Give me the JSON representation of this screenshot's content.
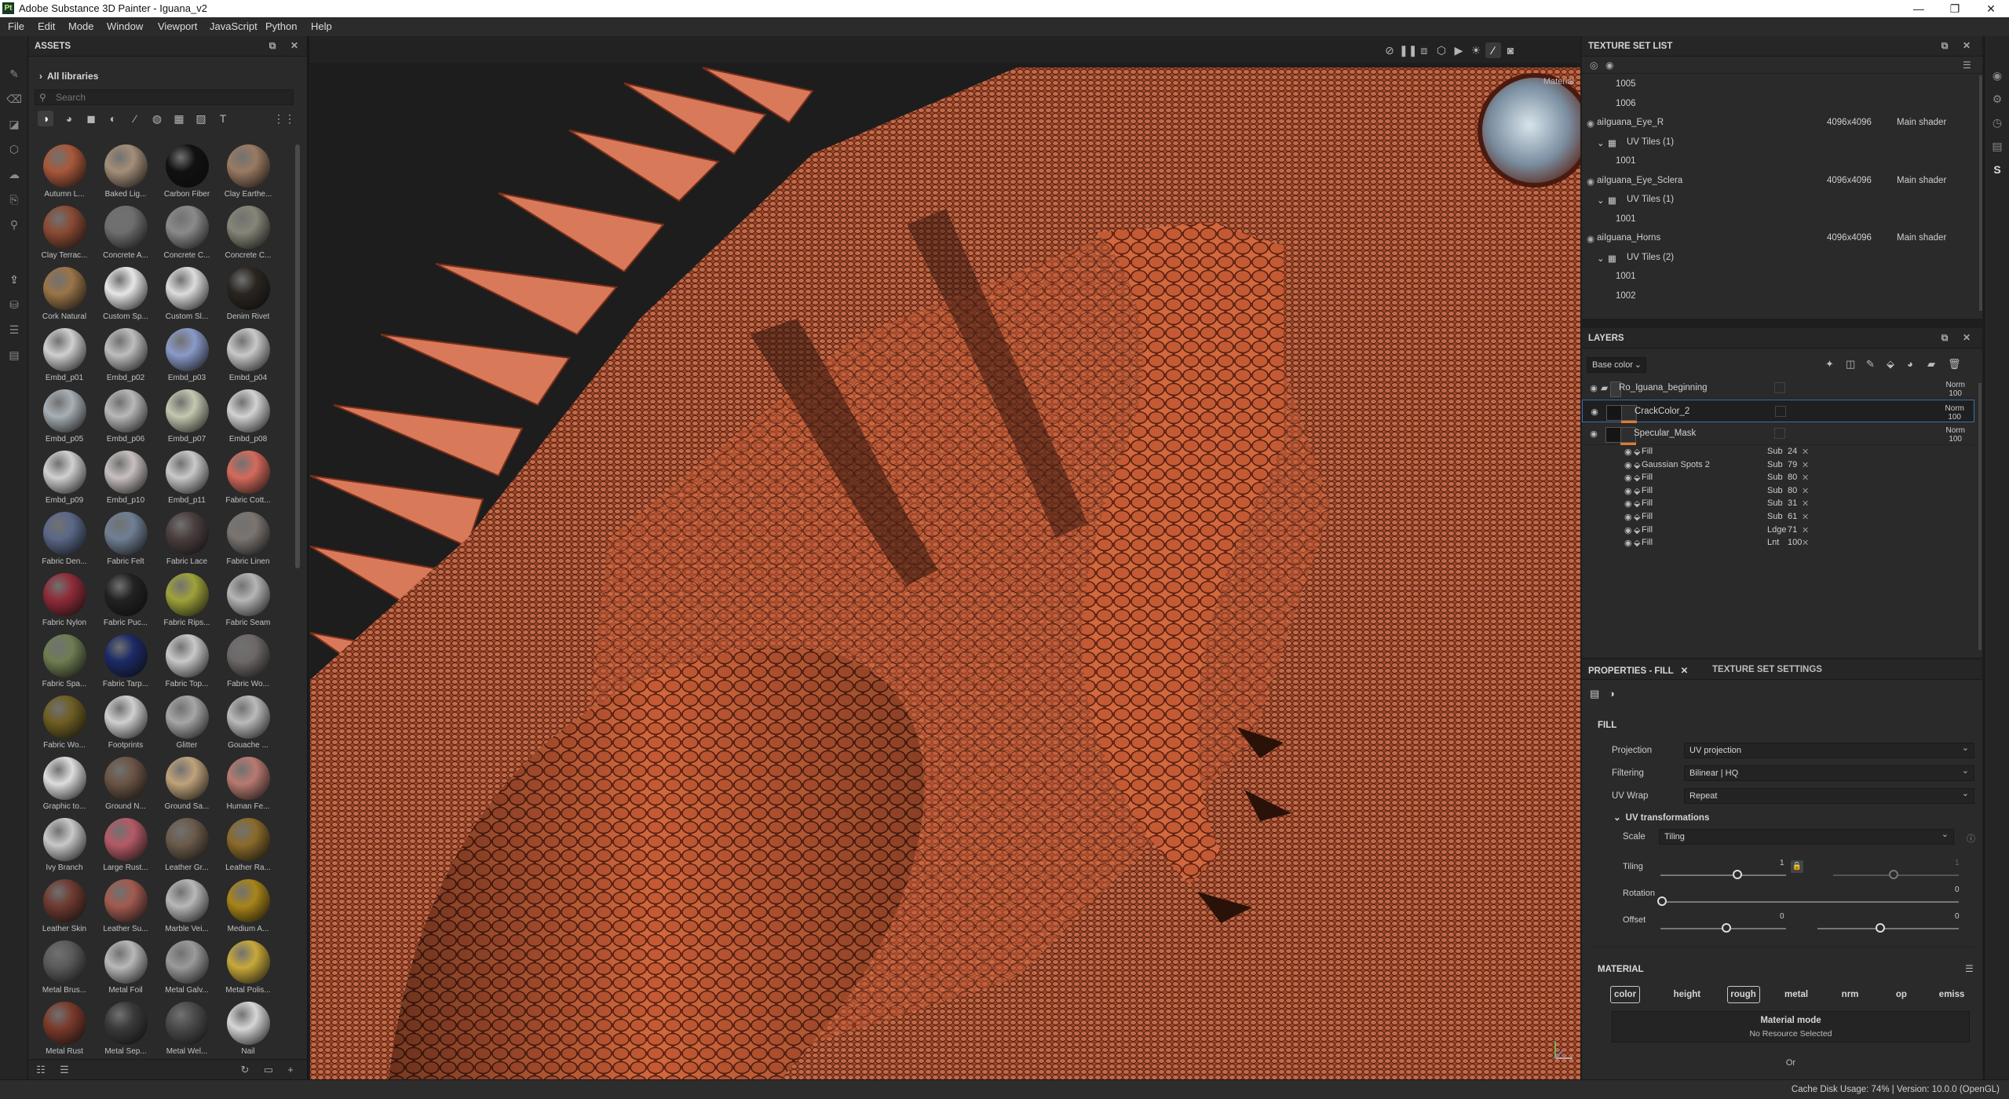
{
  "window": {
    "title": "Adobe Substance 3D Painter - Iguana_v2",
    "logo": "Pt",
    "controls": [
      "—",
      "❐",
      "✕"
    ]
  },
  "menu": [
    "File",
    "Edit",
    "Mode",
    "Window",
    "Viewport",
    "JavaScript",
    "Python",
    "Help"
  ],
  "assets": {
    "header": "ASSETS",
    "library": "All libraries",
    "search_placeholder": "Search",
    "items": [
      {
        "label": "Autumn L...",
        "color": "#a8583a"
      },
      {
        "label": "Baked Lig...",
        "color": "#a48e78"
      },
      {
        "label": "Carbon Fiber",
        "color": "#111111"
      },
      {
        "label": "Clay Earthe...",
        "color": "#9a7a62"
      },
      {
        "label": "Clay Terrac...",
        "color": "#8a4a33"
      },
      {
        "label": "Concrete A...",
        "color": "#6e6e6e"
      },
      {
        "label": "Concrete C...",
        "color": "#8a8a8a"
      },
      {
        "label": "Concrete C...",
        "color": "#858578"
      },
      {
        "label": "Cork Natural",
        "color": "#9a7448"
      },
      {
        "label": "Custom Sp...",
        "color": "#e6e6e6"
      },
      {
        "label": "Custom Sl...",
        "color": "#dcdcdc"
      },
      {
        "label": "Denim Rivet",
        "color": "#2a2520"
      },
      {
        "label": "Embd_p01",
        "color": "#cfcfcf"
      },
      {
        "label": "Embd_p02",
        "color": "#bdbdbd"
      },
      {
        "label": "Embd_p03",
        "color": "#8a9ac8"
      },
      {
        "label": "Embd_p04",
        "color": "#c8c8c8"
      },
      {
        "label": "Embd_p05",
        "color": "#a7b0b5"
      },
      {
        "label": "Embd_p06",
        "color": "#b8b8b8"
      },
      {
        "label": "Embd_p07",
        "color": "#c3c8b0"
      },
      {
        "label": "Embd_p08",
        "color": "#d2d2d2"
      },
      {
        "label": "Embd_p09",
        "color": "#d0d0d0"
      },
      {
        "label": "Embd_p10",
        "color": "#c8c0c0"
      },
      {
        "label": "Embd_p11",
        "color": "#c9c9c9"
      },
      {
        "label": "Fabric Cott...",
        "color": "#d46a5c"
      },
      {
        "label": "Fabric Den...",
        "color": "#5a6888"
      },
      {
        "label": "Fabric Felt",
        "color": "#6f7f94"
      },
      {
        "label": "Fabric Lace",
        "color": "#4a3e3e"
      },
      {
        "label": "Fabric Linen",
        "color": "#7a7470"
      },
      {
        "label": "Fabric Nylon",
        "color": "#8f2b38"
      },
      {
        "label": "Fabric Puc...",
        "color": "#222222"
      },
      {
        "label": "Fabric Rips...",
        "color": "#9ea23a"
      },
      {
        "label": "Fabric Seam",
        "color": "#b5b5b5"
      },
      {
        "label": "Fabric Spa...",
        "color": "#6e7d52"
      },
      {
        "label": "Fabric Tarp...",
        "color": "#1c2a66"
      },
      {
        "label": "Fabric Top...",
        "color": "#c8c8c8"
      },
      {
        "label": "Fabric Wo...",
        "color": "#6e6868"
      },
      {
        "label": "Fabric Wo...",
        "color": "#6e5e22"
      },
      {
        "label": "Footprints",
        "color": "#cfcfcf"
      },
      {
        "label": "Glitter",
        "color": "#a6a6a6"
      },
      {
        "label": "Gouache ...",
        "color": "#bababa"
      },
      {
        "label": "Graphic to...",
        "color": "#dddddd"
      },
      {
        "label": "Ground N...",
        "color": "#6a5444"
      },
      {
        "label": "Ground Sa...",
        "color": "#bfa27a"
      },
      {
        "label": "Human Fe...",
        "color": "#b87a70"
      },
      {
        "label": "Ivy Branch",
        "color": "#c8c8c8"
      },
      {
        "label": "Large Rust...",
        "color": "#b45a66"
      },
      {
        "label": "Leather Gr...",
        "color": "#6a5a4a"
      },
      {
        "label": "Leather Ra...",
        "color": "#8a6a2a"
      },
      {
        "label": "Leather Skin",
        "color": "#6e3a30"
      },
      {
        "label": "Leather Su...",
        "color": "#a25a50"
      },
      {
        "label": "Marble Vei...",
        "color": "#b8b8b8"
      },
      {
        "label": "Medium A...",
        "color": "#a88418"
      },
      {
        "label": "Metal Brus...",
        "color": "#5a5a5a"
      },
      {
        "label": "Metal Foil",
        "color": "#b8b8b8"
      },
      {
        "label": "Metal Galv...",
        "color": "#9a9a9a"
      },
      {
        "label": "Metal Polis...",
        "color": "#c8a83a"
      },
      {
        "label": "Metal Rust",
        "color": "#7a3a2a"
      },
      {
        "label": "Metal Sep...",
        "color": "#3a3a3a"
      },
      {
        "label": "Metal Wel...",
        "color": "#4a4a4a"
      },
      {
        "label": "Nail",
        "color": "#d6d6d6"
      }
    ]
  },
  "viewport": {
    "tag": "Material",
    "tools": [
      "eye-off",
      "pause",
      "uv-2d",
      "cube",
      "camera-video",
      "lights",
      "brush",
      "camera"
    ]
  },
  "texture_set_list": {
    "header": "TEXTURE SET LIST",
    "rows": [
      {
        "type": "tile",
        "text": "1005"
      },
      {
        "type": "tile",
        "text": "1006"
      },
      {
        "type": "set",
        "text": "aiIguana_Eye_R",
        "res": "4096x4096",
        "shader": "Main shader"
      },
      {
        "type": "uv",
        "text": "UV Tiles (1)"
      },
      {
        "type": "tile",
        "text": "1001"
      },
      {
        "type": "set",
        "text": "aiIguana_Eye_Sclera",
        "res": "4096x4096",
        "shader": "Main shader"
      },
      {
        "type": "uv",
        "text": "UV Tiles (1)"
      },
      {
        "type": "tile",
        "text": "1001"
      },
      {
        "type": "set",
        "text": "aiIguana_Horns",
        "res": "4096x4096",
        "shader": "Main shader"
      },
      {
        "type": "uv",
        "text": "UV Tiles (2)"
      },
      {
        "type": "tile",
        "text": "1001"
      },
      {
        "type": "tile",
        "text": "1002"
      }
    ]
  },
  "layers": {
    "header": "LAYERS",
    "channel": "Base color",
    "rows": [
      {
        "name": "Ro_Iguana_beginning",
        "blend": "Norm",
        "opacity": "100",
        "kind": "folder"
      },
      {
        "name": "CrackColor_2",
        "blend": "Norm",
        "opacity": "100",
        "kind": "fill"
      },
      {
        "name": "Specular_Mask",
        "blend": "Norm",
        "opacity": "100",
        "kind": "fill"
      }
    ],
    "effects": [
      {
        "name": "Fill",
        "blend": "Sub",
        "opacity": "24"
      },
      {
        "name": "Gaussian Spots 2",
        "blend": "Sub",
        "opacity": "79"
      },
      {
        "name": "Fill",
        "blend": "Sub",
        "opacity": "80"
      },
      {
        "name": "Fill",
        "blend": "Sub",
        "opacity": "80"
      },
      {
        "name": "Fill",
        "blend": "Sub",
        "opacity": "31"
      },
      {
        "name": "Fill",
        "blend": "Sub",
        "opacity": "61"
      },
      {
        "name": "Fill",
        "blend": "Ldge",
        "opacity": "71"
      },
      {
        "name": "Fill",
        "blend": "Lnt",
        "opacity": "100"
      }
    ]
  },
  "properties": {
    "tab_fill": "PROPERTIES - FILL",
    "tab_tss": "TEXTURE SET SETTINGS",
    "section_fill": "FILL",
    "projection_label": "Projection",
    "projection": "UV projection",
    "filtering_label": "Filtering",
    "filtering": "Bilinear | HQ",
    "uvwrap_label": "UV Wrap",
    "uvwrap": "Repeat",
    "uvtrans": "UV transformations",
    "scale_label": "Scale",
    "scale": "Tiling",
    "tiling_label": "Tiling",
    "tiling_value": "1",
    "tiling_value2": "1",
    "rotation_label": "Rotation",
    "rotation_value": "0",
    "offset_label": "Offset",
    "offset_x": "0",
    "offset_y": "0",
    "section_material": "MATERIAL",
    "channels": [
      {
        "t": "color",
        "on": true
      },
      {
        "t": "height",
        "on": false
      },
      {
        "t": "rough",
        "on": true
      },
      {
        "t": "metal",
        "on": false
      },
      {
        "t": "nrm",
        "on": false
      },
      {
        "t": "op",
        "on": false
      },
      {
        "t": "emiss",
        "on": false
      }
    ],
    "material_mode": "Material mode",
    "no_resource": "No Resource Selected",
    "or": "Or"
  },
  "status": {
    "text": "Cache Disk Usage:   74% | Version: 10.0.0 (OpenGL)"
  },
  "colors": {
    "accent": "#e07a2e",
    "selected": "#3a6fb5",
    "bg": "#2a2a2a"
  }
}
